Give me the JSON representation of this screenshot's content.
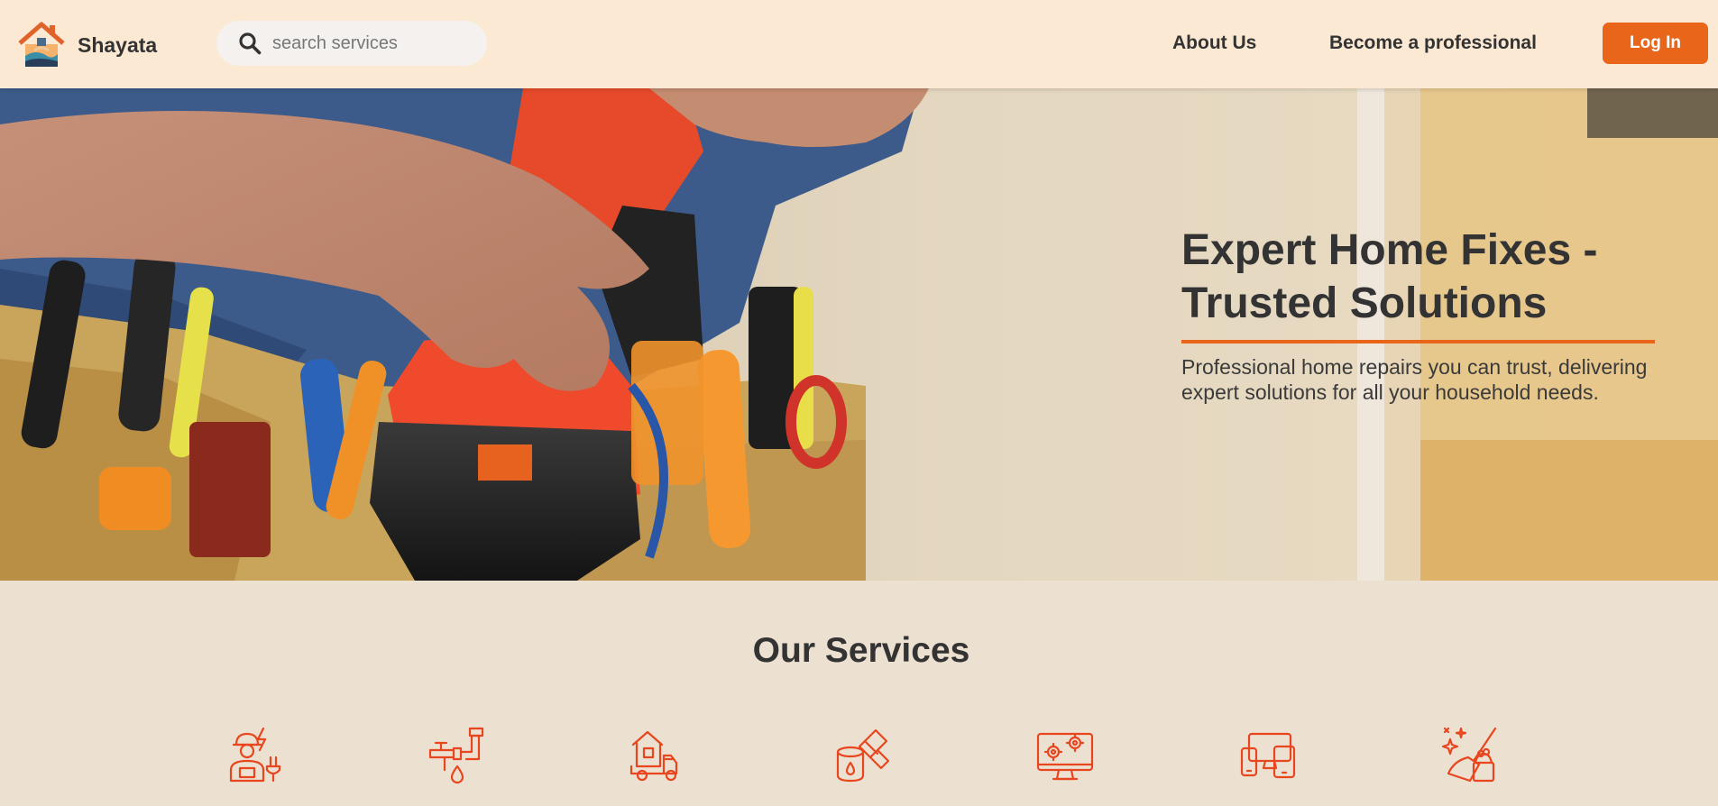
{
  "brand": {
    "name": "Shayata"
  },
  "search": {
    "placeholder": "search services",
    "value": ""
  },
  "nav": {
    "about": "About Us",
    "professional": "Become a professional",
    "login": "Log In"
  },
  "hero": {
    "title_line1": "Expert Home Fixes -",
    "title_line2": "Trusted Solutions",
    "subtitle": "Professional home repairs you can trust, delivering expert solutions for all your household needs."
  },
  "services": {
    "title": "Our Services",
    "icons": [
      "electrician-icon",
      "plumbing-icon",
      "house-moving-icon",
      "painting-icon",
      "tech-setup-icon",
      "device-repair-icon",
      "cleaning-icon"
    ]
  },
  "colors": {
    "accent": "#e8651a",
    "nav_bg": "#fce9d4",
    "page_bg": "#ece0d1",
    "icon": "#e8461e",
    "text": "#333333"
  }
}
